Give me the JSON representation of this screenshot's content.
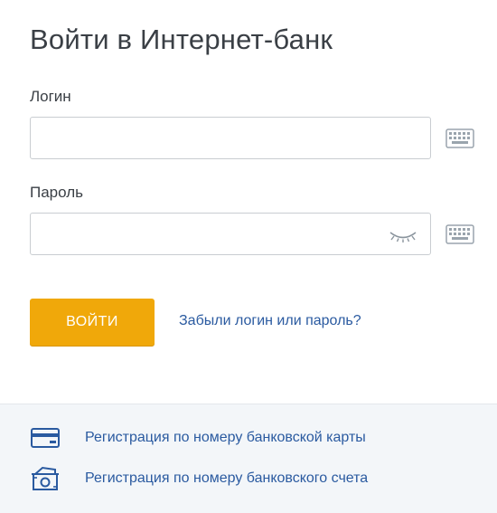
{
  "form": {
    "title": "Войти в Интернет-банк",
    "login_label": "Логин",
    "login_value": "",
    "password_label": "Пароль",
    "password_value": "",
    "submit_label": "ВОЙТИ",
    "forgot_link": "Забыли логин или пароль?"
  },
  "icons": {
    "keyboard": "keyboard-icon",
    "eye_closed": "eye-closed-icon",
    "card": "bank-card-icon",
    "account": "bank-account-icon"
  },
  "registration": {
    "items": [
      {
        "label": "Регистрация по номеру банковской карты",
        "icon": "bank-card-icon"
      },
      {
        "label": "Регистрация по номеру банковского счета",
        "icon": "bank-account-icon"
      }
    ]
  },
  "colors": {
    "accent_button": "#f0a80a",
    "link": "#2a5aa0",
    "footer_bg": "#f3f6f9",
    "icon_blue": "#2a5aa0"
  }
}
